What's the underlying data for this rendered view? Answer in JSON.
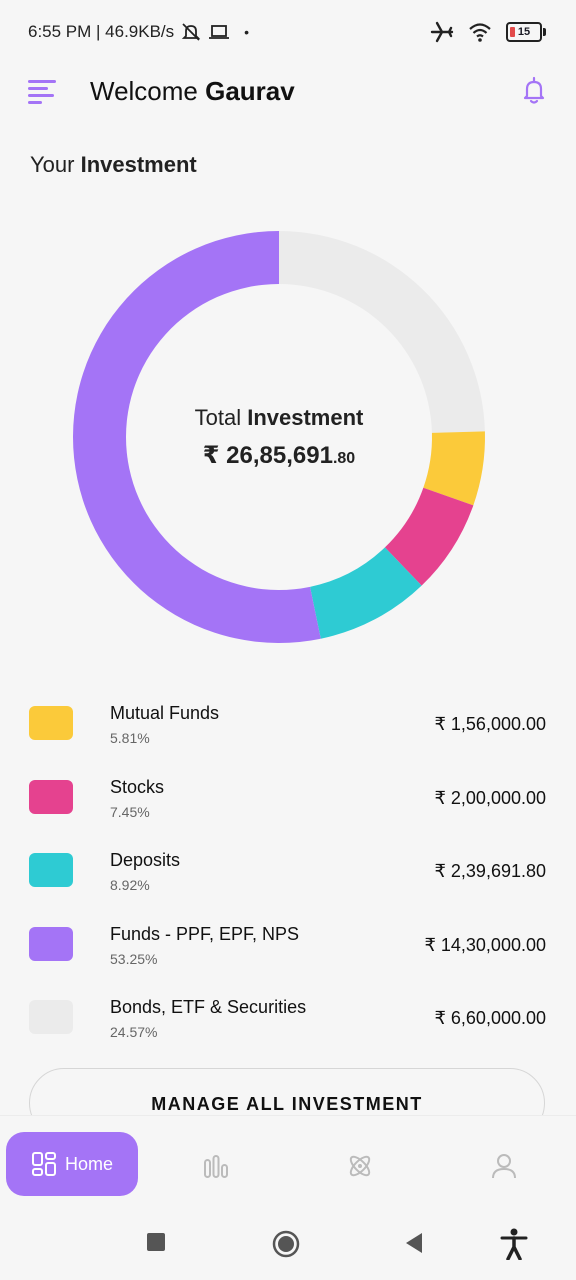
{
  "status_bar": {
    "time_speed": "6:55 PM | 46.9KB/s",
    "battery": "15"
  },
  "header": {
    "welcome_prefix": "Welcome ",
    "user_name": "Gaurav"
  },
  "section": {
    "title_prefix": "Your ",
    "title_bold": "Investment"
  },
  "summary": {
    "label_prefix": "Total ",
    "label_bold": "Investment",
    "amount_main": "₹ 26,85,691",
    "amount_decimal": ".80"
  },
  "chart_data": {
    "type": "pie",
    "categories": [
      "Mutual Funds",
      "Stocks",
      "Deposits",
      "Funds - PPF, EPF, NPS",
      "Bonds, ETF & Securities"
    ],
    "values": [
      5.81,
      7.45,
      8.92,
      53.25,
      24.57
    ],
    "colors": [
      "#fbca3a",
      "#e5428f",
      "#2ecbd3",
      "#a474f6",
      "#ebebeb"
    ],
    "donut": true
  },
  "investments": [
    {
      "name": "Mutual Funds",
      "percent": "5.81%",
      "amount": "₹ 1,56,000.00",
      "color": "#fbca3a"
    },
    {
      "name": "Stocks",
      "percent": "7.45%",
      "amount": "₹ 2,00,000.00",
      "color": "#e5428f"
    },
    {
      "name": "Deposits",
      "percent": "8.92%",
      "amount": "₹ 2,39,691.80",
      "color": "#2ecbd3"
    },
    {
      "name": "Funds - PPF, EPF, NPS",
      "percent": "53.25%",
      "amount": "₹ 14,30,000.00",
      "color": "#a474f6"
    },
    {
      "name": "Bonds, ETF & Securities",
      "percent": "24.57%",
      "amount": "₹ 6,60,000.00",
      "color": "#ebebeb"
    }
  ],
  "manage_button": "MANAGE ALL INVESTMENT",
  "bottom_nav": {
    "home_label": "Home",
    "icons": [
      "dashboard-icon",
      "bar-chart-icon",
      "atom-icon",
      "person-icon"
    ]
  },
  "accent_color": "#a474f6"
}
